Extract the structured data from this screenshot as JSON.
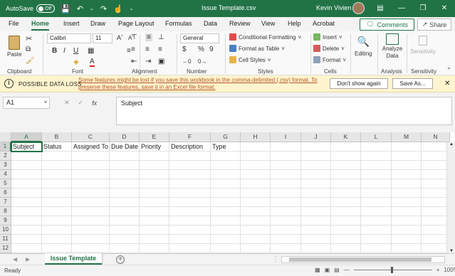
{
  "titlebar": {
    "autosave_label": "AutoSave",
    "autosave_state": "Off",
    "file_title": "Issue Template.csv",
    "user_name": "Kevin Vivien"
  },
  "ribbon_tabs": [
    "File",
    "Home",
    "Insert",
    "Draw",
    "Page Layout",
    "Formulas",
    "Data",
    "Review",
    "View",
    "Help",
    "Acrobat"
  ],
  "active_tab": "Home",
  "actions": {
    "comments": "Comments",
    "share": "Share"
  },
  "ribbon": {
    "clipboard": {
      "paste": "Paste",
      "label": "Clipboard"
    },
    "font": {
      "name": "Calibri",
      "size": "11",
      "label": "Font"
    },
    "alignment": {
      "label": "Alignment"
    },
    "number": {
      "format": "General",
      "label": "Number"
    },
    "styles": {
      "conditional": "Conditional Formatting",
      "format_table": "Format as Table",
      "cell_styles": "Cell Styles",
      "label": "Styles"
    },
    "cells": {
      "insert": "Insert",
      "delete": "Delete",
      "format": "Format",
      "label": "Cells"
    },
    "editing": {
      "label": "Editing"
    },
    "analysis": {
      "analyze": "Analyze Data",
      "label": "Analysis"
    },
    "sensitivity": {
      "button": "Sensitivity",
      "label": "Sensitivity"
    }
  },
  "message_bar": {
    "title": "POSSIBLE DATA LOSS",
    "text": "Some features might be lost if you save this workbook in the comma-delimited (.csv) format. To preserve these features, save it in an Excel file format.",
    "dont_show": "Don't show again",
    "save_as": "Save As..."
  },
  "formula_bar": {
    "name_box": "A1",
    "content": "Subject"
  },
  "grid": {
    "columns": [
      "A",
      "B",
      "C",
      "D",
      "E",
      "F",
      "G",
      "H",
      "I",
      "J",
      "K",
      "L",
      "M",
      "N"
    ],
    "rows": [
      "1",
      "2",
      "3",
      "4",
      "5",
      "6",
      "7",
      "8",
      "9",
      "10",
      "11",
      "12"
    ],
    "row1": [
      "Subject",
      "Status",
      "Assigned To",
      "Due Date",
      "Priority",
      "Description",
      "Type"
    ]
  },
  "sheet_tab": "Issue Template",
  "status": {
    "ready": "Ready",
    "zoom": "100%"
  },
  "colors": {
    "accent": "#217346",
    "warning_bg": "#fff4ce",
    "link": "#b5572a"
  }
}
